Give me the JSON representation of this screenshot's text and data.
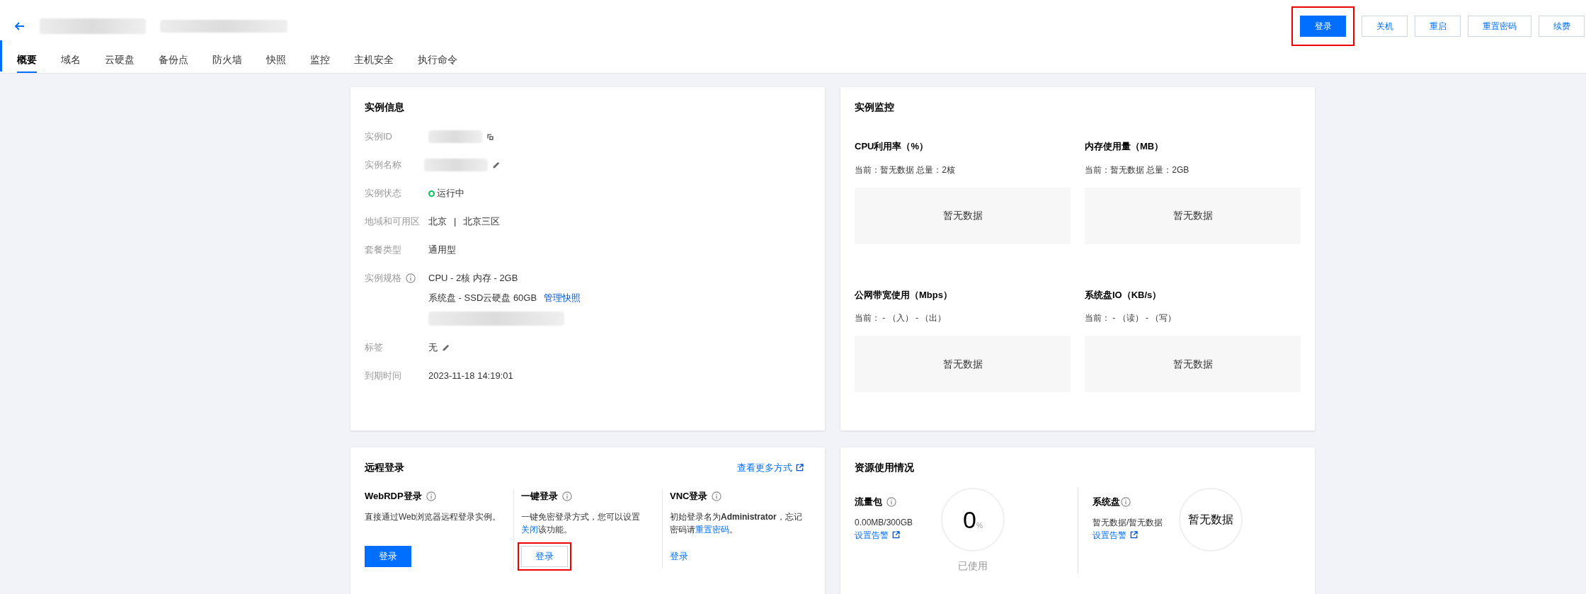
{
  "header": {
    "actions": [
      {
        "label": "登录",
        "kind": "primary",
        "highlighted": true
      },
      {
        "label": "关机",
        "kind": "default",
        "highlighted": false
      },
      {
        "label": "重启",
        "kind": "default",
        "highlighted": false
      },
      {
        "label": "重置密码",
        "kind": "default",
        "highlighted": false
      },
      {
        "label": "续费",
        "kind": "default",
        "highlighted": false
      }
    ]
  },
  "tabs": [
    {
      "label": "概要",
      "selected": true
    },
    {
      "label": "域名",
      "selected": false
    },
    {
      "label": "云硬盘",
      "selected": false
    },
    {
      "label": "备份点",
      "selected": false
    },
    {
      "label": "防火墙",
      "selected": false
    },
    {
      "label": "快照",
      "selected": false
    },
    {
      "label": "监控",
      "selected": false
    },
    {
      "label": "主机安全",
      "selected": false
    },
    {
      "label": "执行命令",
      "selected": false
    }
  ],
  "instance_info": {
    "title": "实例信息",
    "rows": [
      {
        "label": "实例ID",
        "kind": "copyable"
      },
      {
        "label": "实例名称",
        "kind": "editable_hidden"
      },
      {
        "label": "实例状态",
        "kind": "status",
        "value": "运行中"
      },
      {
        "label": "地域和可用区",
        "kind": "region",
        "values": [
          "北京",
          "|",
          "北京三区"
        ]
      },
      {
        "label": "套餐类型",
        "kind": "text",
        "value": "通用型"
      },
      {
        "label": "实例规格",
        "kind": "spec",
        "lines": [
          "CPU - 2核 内存 - 2GB",
          "系统盘 - SSD云硬盘 60GB"
        ],
        "link": "管理快照"
      },
      {
        "label": "标签",
        "kind": "editable",
        "value": "无"
      },
      {
        "label": "到期时间",
        "kind": "text",
        "value": "2023-11-18 14:19:01"
      }
    ]
  },
  "monitoring": {
    "title": "实例监控",
    "charts": [
      {
        "title": "CPU利用率（%）",
        "current": "当前：暂无数据 总量：2核",
        "empty": "暂无数据"
      },
      {
        "title": "内存使用量（MB）",
        "current": "当前：暂无数据 总量：2GB",
        "empty": "暂无数据"
      },
      {
        "title": "公网带宽使用（Mbps）",
        "current": "当前： - （入） - （出）",
        "empty": "暂无数据"
      },
      {
        "title": "系统盘IO（KB/s）",
        "current": "当前： - （读） - （写）",
        "empty": "暂无数据"
      }
    ]
  },
  "remote_login": {
    "title": "远程登录",
    "more_link": "查看更多方式",
    "methods": [
      {
        "title": "WebRDP登录",
        "text_before": "直接通过Web浏览器远程登录实例。",
        "button": "登录",
        "kind": "primary",
        "highlighted": false
      },
      {
        "title": "一键登录",
        "text_before": "一键免密登录方式，您可以设置",
        "link": "关闭",
        "text_after": "该功能。",
        "button": "登录",
        "kind": "outlined",
        "highlighted": true
      },
      {
        "title": "VNC登录",
        "text_before": "初始登录名为**Administrator**，忘记密码请",
        "link": "重置密码",
        "text_after": "。",
        "button": "登录",
        "kind": "link",
        "highlighted": false
      }
    ]
  },
  "resources": {
    "title": "资源使用情况",
    "items": [
      {
        "title": "流量包",
        "kind": "traffic",
        "amount": "0.00MB/300GB",
        "link": "设置告警",
        "gauge_value": "0",
        "gauge_unit": "%",
        "caption": "已使用"
      },
      {
        "title": "系统盘",
        "kind": "disk",
        "amount": "暂无数据/暂无数据",
        "link": "设置告警",
        "gauge_text": "暂无数据"
      }
    ]
  }
}
